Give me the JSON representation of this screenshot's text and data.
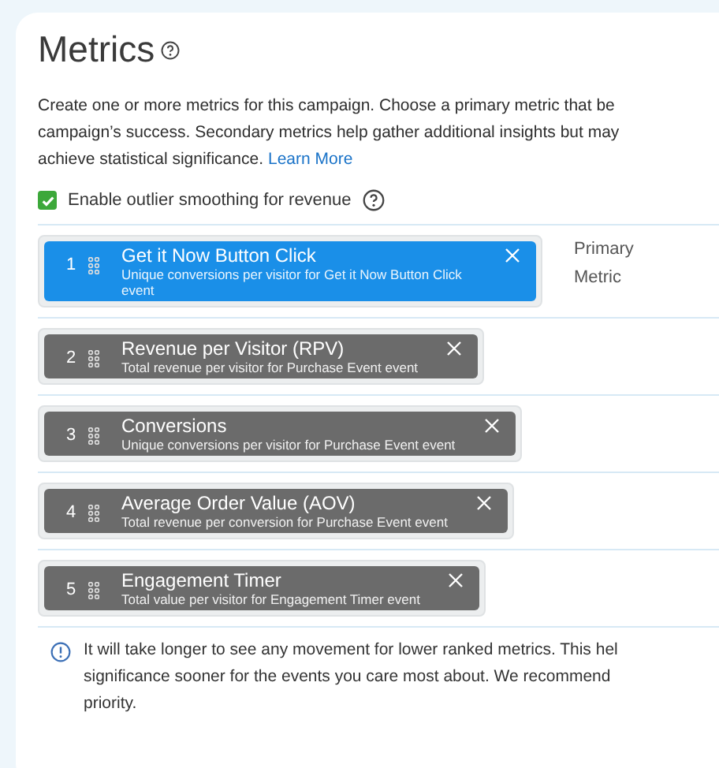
{
  "title": "Metrics",
  "intro": {
    "lines": [
      "Create one or more metrics for this campaign. Choose a primary metric that be",
      "campaign’s success. Secondary metrics help gather additional insights but may",
      "achieve statistical significance."
    ],
    "link": "Learn More"
  },
  "outlier_smoothing": {
    "label": "Enable outlier smoothing for revenue",
    "checked": true
  },
  "metrics": [
    {
      "rank": "1",
      "name": "Get it Now Button Click",
      "description": "Unique conversions per visitor for Get it Now Button Click event",
      "selected": true,
      "role": "Primary Metric"
    },
    {
      "rank": "2",
      "name": "Revenue per Visitor (RPV)",
      "description": "Total revenue per visitor for Purchase Event event",
      "selected": false
    },
    {
      "rank": "3",
      "name": "Conversions",
      "description": "Unique conversions per visitor for Purchase Event event",
      "selected": false
    },
    {
      "rank": "4",
      "name": "Average Order Value (AOV)",
      "description": "Total revenue per conversion for Purchase Event event",
      "selected": false
    },
    {
      "rank": "5",
      "name": "Engagement Timer",
      "description": "Total value per visitor for Engagement Timer event",
      "selected": false
    }
  ],
  "notice": {
    "lines": [
      "It will take longer to see any movement for lower ranked metrics. This hel",
      "significance sooner for the events you care most about. We recommend",
      "priority."
    ]
  }
}
